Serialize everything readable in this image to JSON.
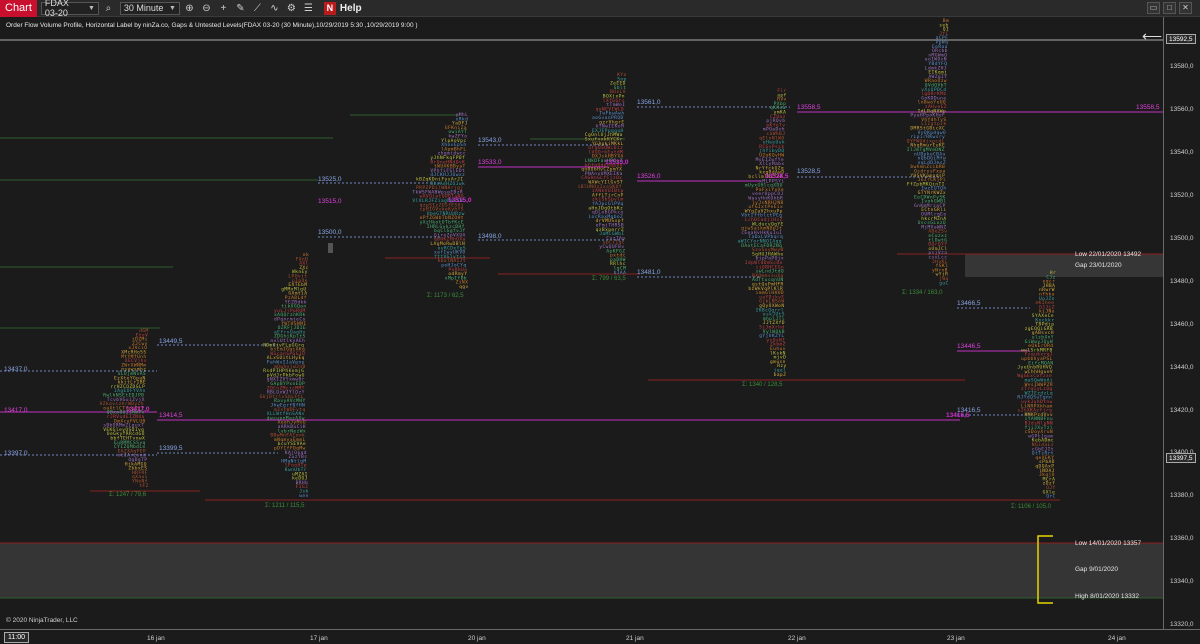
{
  "toolbar": {
    "chart_tab": "Chart",
    "instrument": "FDAX 03-20",
    "interval": "30 Minute",
    "help": "Help",
    "icons": [
      "search-icon",
      "zoom-in-icon",
      "zoom-out-icon",
      "crosshair-icon",
      "drawing-icon",
      "line-icon",
      "indicator-icon",
      "strategy-icon",
      "properties-icon",
      "ninja-icon"
    ]
  },
  "chart": {
    "title": "Order Flow Volume Profile, Horizontal Label by ninZa.co, Gaps & Untested Levels(FDAX 03-20 (30 Minute),10/29/2019 5:30 ,10/29/2019 9:00 )",
    "copyright": "© 2020 NinjaTrader, LLC",
    "current_time": "11:00",
    "current_price": "13397,5",
    "top_price": "13592,5",
    "price_labels": [
      "13580,0",
      "13560,0",
      "13540,0",
      "13520,0",
      "13500,0",
      "13480,0",
      "13460,0",
      "13440,0",
      "13420,0",
      "13400,0",
      "13380,0",
      "13360,0",
      "13340,0",
      "13320,0"
    ],
    "time_labels": [
      "16 jan",
      "17 jan",
      "20 jan",
      "21 jan",
      "22 jan",
      "23 jan",
      "24 jan"
    ],
    "levels_blue": [
      "13437,0",
      "13397,0",
      "13449,5",
      "13399,5",
      "13525,0",
      "13500,0",
      "13543,0",
      "13498,0",
      "13561,0",
      "13481,0",
      "13528,5",
      "13466,5",
      "13416,5"
    ],
    "levels_magenta": [
      "13417,0",
      "13414,5",
      "13515,0",
      "13533,0",
      "13526,0",
      "13558,5",
      "13446,5",
      "13558,5"
    ],
    "poc_labels": [
      "13417,0",
      "13515,0",
      "13533,0",
      "13528,5",
      "13416,5"
    ],
    "stats": [
      "Σ: 1247 / 79,6",
      "Σ: 1211 / 115,5",
      "Σ: 1173 / 62,5",
      "Σ: 799 / 63,5",
      "Σ: 1340 / 128,5",
      "Σ: 1334 / 163,0",
      "Σ: 1106 / 105,0"
    ],
    "gaps": {
      "upper_low": "Low 22/01/2020 13492",
      "upper_gap": "Gap 23/01/2020",
      "lower_low": "Low 14/01/2020 13357",
      "lower_gap": "Gap 9/01/2020",
      "lower_high": "High 8/01/2020 13332"
    },
    "colors": {
      "background": "#1b1b1b",
      "level_blue": "#8aa6e8",
      "level_magenta": "#e040e0",
      "gap_band": "#3a3a3a",
      "brackets": "#e6d400",
      "stat_green": "#3a8e3a",
      "tpo_gold": "#d4a93a"
    }
  }
}
